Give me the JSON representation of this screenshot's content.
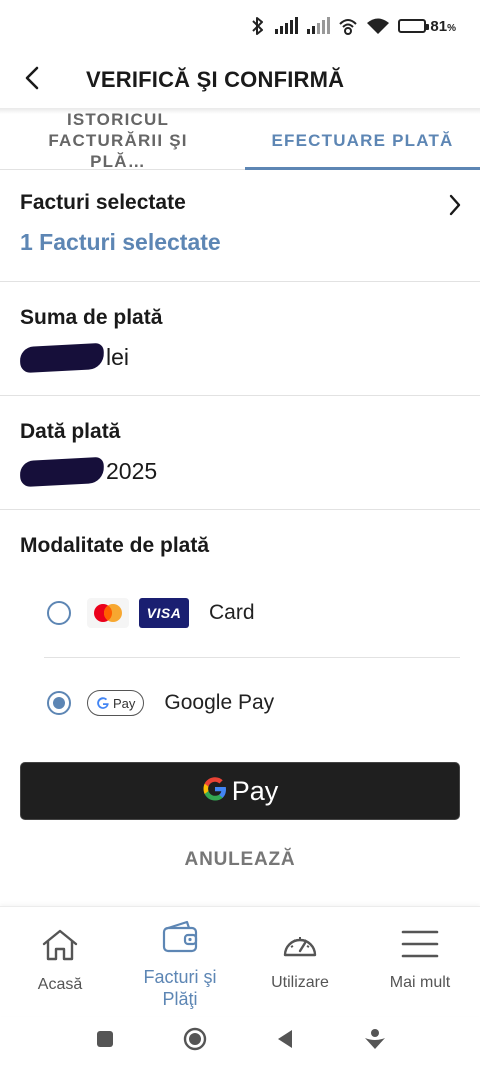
{
  "status_bar": {
    "battery_percent": "81",
    "battery_level": 0.81,
    "icons": [
      "bluetooth-icon",
      "signal-icon",
      "signal-icon",
      "wifi-calling-icon",
      "wifi-icon",
      "battery-icon"
    ]
  },
  "header": {
    "title": "VERIFICĂ ŞI CONFIRMĂ",
    "back_icon": "back-arrow-icon"
  },
  "tabs": [
    {
      "label": "ISTORICUL FACTURĂRII ŞI PLĂ…",
      "active": false
    },
    {
      "label": "EFECTUARE PLATĂ",
      "active": true
    }
  ],
  "invoices": {
    "label": "Facturi selectate",
    "value": "1 Facturi selectate"
  },
  "amount": {
    "label": "Suma de plată",
    "suffix": "lei"
  },
  "date": {
    "label": "Dată plată",
    "suffix": "2025"
  },
  "payment_method": {
    "label": "Modalitate de plată",
    "options": [
      {
        "label": "Card",
        "selected": false,
        "badges": [
          "mastercard-icon",
          "visa-icon"
        ]
      },
      {
        "label": "Google Pay",
        "selected": true,
        "badges": [
          "google-pay-icon"
        ]
      }
    ],
    "visa_text": "VISA",
    "gpay_chip_text": "Pay"
  },
  "gpay_button": {
    "text": "Pay"
  },
  "cancel_label": "ANULEAZĂ",
  "bottom_nav": [
    {
      "label": "Acasă",
      "icon": "home-icon",
      "active": false
    },
    {
      "label": "Facturi şi Plăţi",
      "icon": "wallet-icon",
      "active": true
    },
    {
      "label": "Utilizare",
      "icon": "gauge-icon",
      "active": false
    },
    {
      "label": "Mai mult",
      "icon": "menu-icon",
      "active": false
    }
  ],
  "colors": {
    "accent": "#5d86b4",
    "text": "#1a1a1a",
    "muted": "#777777",
    "gpay_button": "#1f1f1f"
  }
}
